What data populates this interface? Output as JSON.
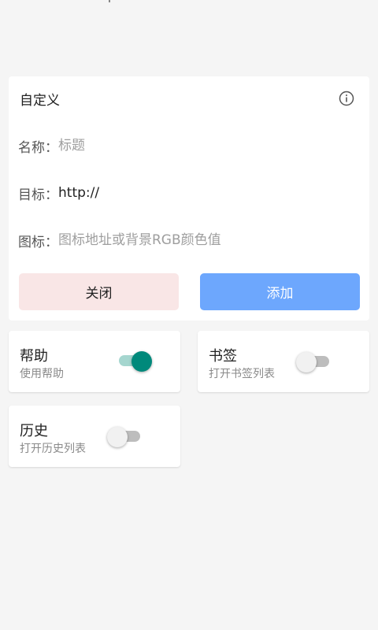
{
  "dialog": {
    "title": "自定义",
    "fields": {
      "name": {
        "label": "名称：",
        "value": "",
        "placeholder": "标题"
      },
      "target": {
        "label": "目标：",
        "value": "http://",
        "placeholder": ""
      },
      "icon": {
        "label": "图标：",
        "value": "",
        "placeholder": "图标地址或背景RGB颜色值"
      }
    },
    "close_label": "关闭",
    "add_label": "添加",
    "info_icon": "info-circle-icon"
  },
  "toggles": [
    {
      "title": "帮助",
      "subtitle": "使用帮助",
      "on": true
    },
    {
      "title": "书签",
      "subtitle": "打开书签列表",
      "on": false
    },
    {
      "title": "历史",
      "subtitle": "打开历史列表",
      "on": false
    }
  ],
  "colors": {
    "background": "#f5f5f5",
    "card": "#ffffff",
    "close_button_bg": "#f9e6e6",
    "add_button_bg": "#6da7fd",
    "switch_on_thumb": "#00897b",
    "switch_on_track": "#a5d6cf",
    "switch_off_track": "#bdbdbd"
  }
}
